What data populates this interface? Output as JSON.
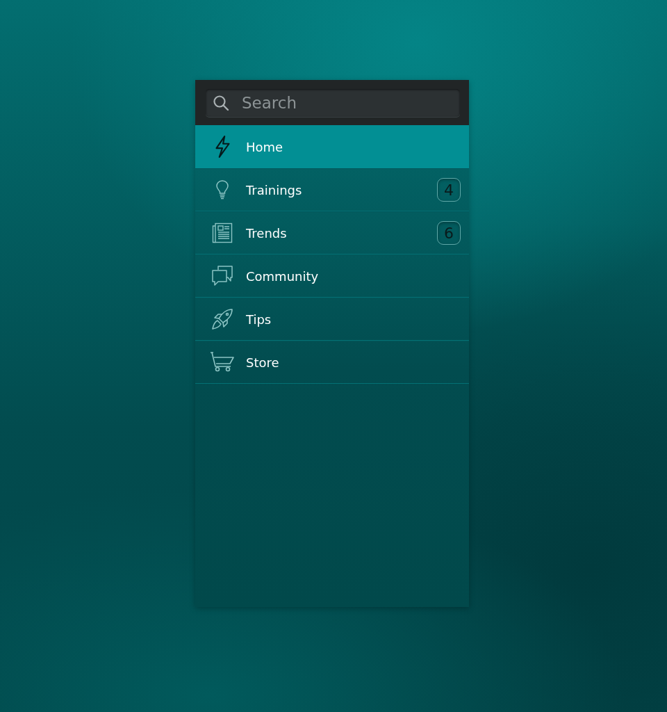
{
  "search": {
    "placeholder": "Search"
  },
  "menu": [
    {
      "label": "Home",
      "selected": true
    },
    {
      "label": "Trainings",
      "selected": false,
      "badge": "4"
    },
    {
      "label": "Trends",
      "selected": false,
      "badge": "6"
    },
    {
      "label": "Community",
      "selected": false
    },
    {
      "label": "Tips",
      "selected": false
    },
    {
      "label": "Store",
      "selected": false
    }
  ]
}
